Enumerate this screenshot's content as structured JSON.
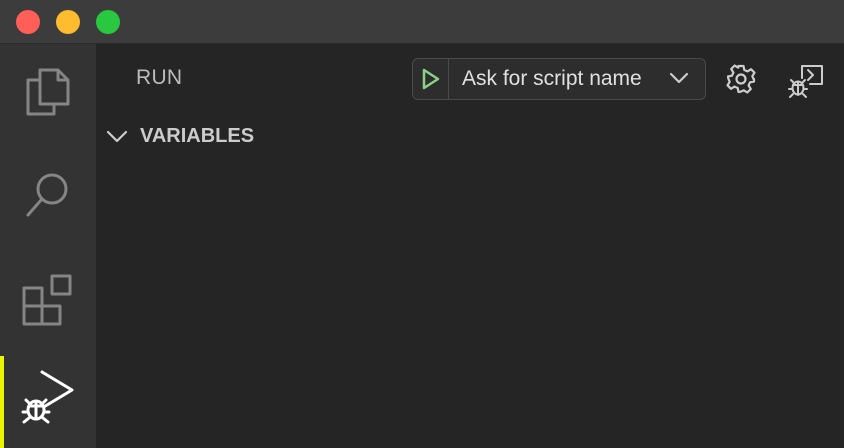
{
  "window": {
    "traffic_lights": [
      "close",
      "minimize",
      "maximize"
    ]
  },
  "activity_bar": {
    "items": [
      {
        "icon": "files-icon",
        "active": false
      },
      {
        "icon": "search-icon",
        "active": false
      },
      {
        "icon": "extensions-icon",
        "active": false
      },
      {
        "icon": "run-debug-icon",
        "active": true
      }
    ],
    "active_indicator_color": "#e8f600"
  },
  "sidebar": {
    "title": "RUN",
    "launch": {
      "selected": "Ask for script name",
      "run_icon_color": "#89d185"
    },
    "sections": [
      {
        "label": "VARIABLES",
        "expanded": true
      }
    ]
  }
}
